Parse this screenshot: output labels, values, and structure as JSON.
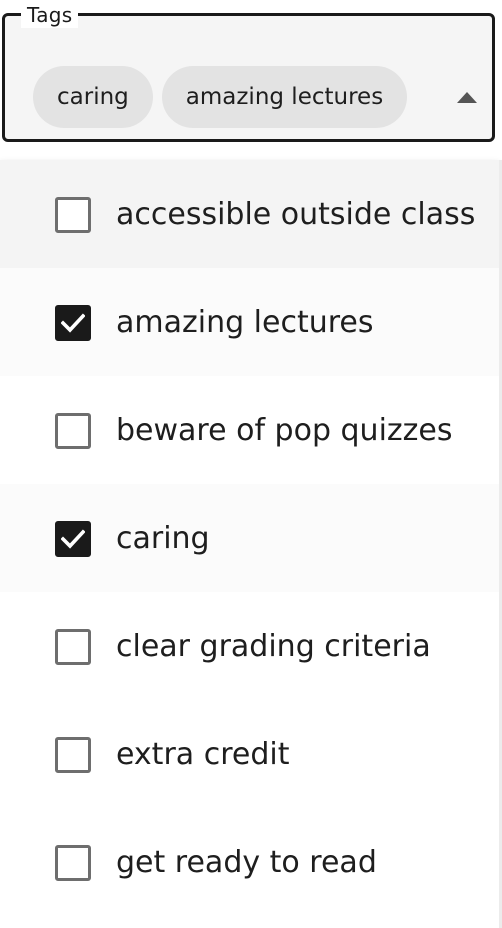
{
  "field": {
    "legend": "Tags",
    "chips": [
      "caring",
      "amazing lectures"
    ]
  },
  "options": [
    {
      "label": "accessible outside class",
      "checked": false
    },
    {
      "label": "amazing lectures",
      "checked": true
    },
    {
      "label": "beware of pop quizzes",
      "checked": false
    },
    {
      "label": "caring",
      "checked": true
    },
    {
      "label": "clear grading criteria",
      "checked": false
    },
    {
      "label": "extra credit",
      "checked": false
    },
    {
      "label": "get ready to read",
      "checked": false
    }
  ],
  "icons": {
    "toggle": "caret-up-icon",
    "check": "checkmark-icon"
  },
  "colors": {
    "checked_fill": "#1a1a1a",
    "chip_bg": "#e3e3e3",
    "hover_bg": "#f4f4f4"
  }
}
